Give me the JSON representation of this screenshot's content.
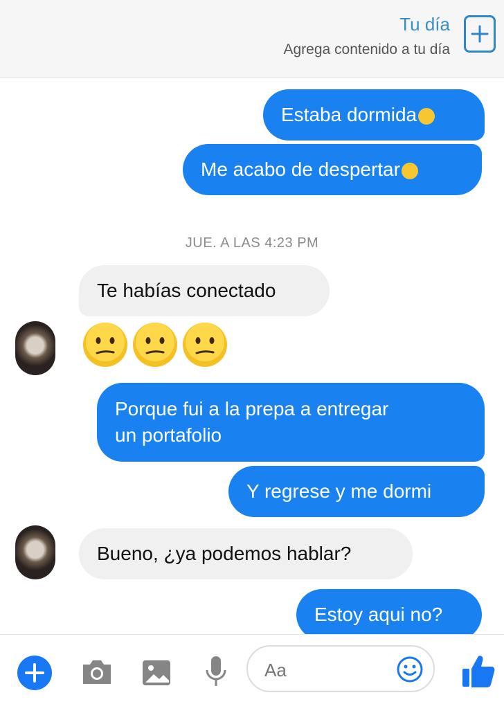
{
  "header": {
    "your_day_title": "Tu día",
    "your_day_subtitle": "Agrega contenido a tu día"
  },
  "messages": [
    {
      "side": "out",
      "text": "Estaba dormida",
      "emoji": "sleepy-face"
    },
    {
      "side": "out",
      "text": "Me acabo de despertar",
      "emoji": "sleepy-face"
    },
    {
      "side": "in",
      "text": "Te habías conectado"
    },
    {
      "side": "in",
      "emojis": [
        "confused-face",
        "confused-face",
        "confused-face"
      ]
    },
    {
      "side": "out",
      "text_line1": "Porque fui a la prepa a entregar",
      "text_line2": "un portafolio"
    },
    {
      "side": "out",
      "text": "Y regrese y me dormi"
    },
    {
      "side": "in",
      "text": "Bueno, ¿ya podemos hablar?"
    },
    {
      "side": "out",
      "text": "Estoy aqui no?"
    }
  ],
  "timestamp": "JUE. A LAS 4:23 PM",
  "composer": {
    "placeholder": "Aa"
  },
  "colors": {
    "outgoing_bubble": "#1a82f0",
    "incoming_bubble": "#f0f0f0",
    "accent": "#1877f2"
  }
}
